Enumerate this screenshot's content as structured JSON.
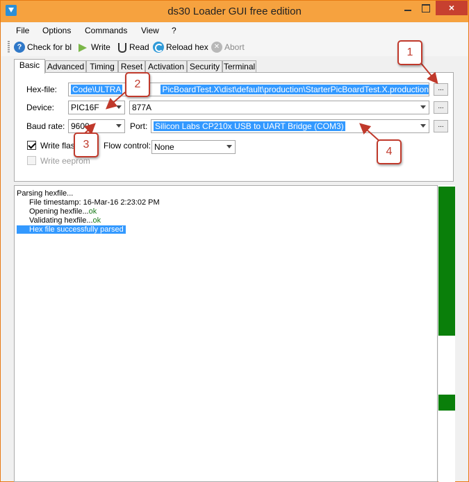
{
  "window": {
    "title": "ds30 Loader GUI free edition",
    "close_glyph": "×"
  },
  "menu": [
    "File",
    "Options",
    "Commands",
    "View",
    "?"
  ],
  "toolbar": {
    "check": "Check for bl",
    "write": "Write",
    "read": "Read",
    "reload": "Reload hex",
    "abort": "Abort"
  },
  "tabs": [
    "Basic",
    "Advanced",
    "Timing",
    "Reset",
    "Activation",
    "Security",
    "Terminal"
  ],
  "basic": {
    "hexfile_label": "Hex-file:",
    "hexfile_value_start": "Code\\ULTRA",
    "hexfile_value_end": "PicBoardTest.X\\dist\\default\\production\\StarterPicBoardTest.X.production.hex",
    "device_label": "Device:",
    "device_family": "PIC16F",
    "device_model": "877A",
    "baud_label": "Baud rate:",
    "baud_value": "9600",
    "port_label": "Port:",
    "port_value": "Silicon Labs CP210x USB to UART Bridge (COM3)",
    "write_flash": "Write flash",
    "flow_label": "Flow control:",
    "flow_value": "None",
    "write_eeprom": "Write eeprom",
    "browse": "..."
  },
  "log": {
    "l1": "Parsing hexfile...",
    "l2": "File timestamp: 16-Mar-16 2:23:02 PM",
    "l3a": "Opening hexfile...",
    "l3b": "ok",
    "l4a": "Validating hexfile...",
    "l4b": "ok",
    "l5": "Hex file successfully parsed"
  },
  "callouts": [
    "1",
    "2",
    "3",
    "4"
  ],
  "colors": {
    "accent": "#f6a23f",
    "selection": "#3399ff",
    "progress": "#0a7f0a",
    "callout": "#c0392b"
  }
}
